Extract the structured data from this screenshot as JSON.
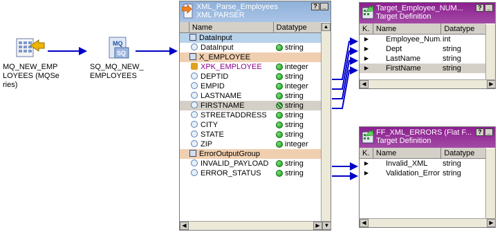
{
  "sources": [
    {
      "label": "MQ_NEW_EMP\nLOYEES (MQSe\nries)"
    },
    {
      "label": "SQ_MQ_NEW_\nEMPLOYEES"
    }
  ],
  "parser": {
    "title": "XML_Parse_Employees",
    "subtitle": "XML PARSER",
    "col_name": "Name",
    "col_type": "Datatype",
    "rows": [
      {
        "kind": "group",
        "name": "DataInput",
        "type": ""
      },
      {
        "kind": "field",
        "name": "DataInput",
        "type": "string"
      },
      {
        "kind": "group",
        "name": "X_EMPLOYEE",
        "type": ""
      },
      {
        "kind": "key",
        "name": "XPK_EMPLOYEE",
        "type": "integer"
      },
      {
        "kind": "field",
        "name": "DEPTID",
        "type": "string"
      },
      {
        "kind": "field",
        "name": "EMPID",
        "type": "integer"
      },
      {
        "kind": "field",
        "name": "LASTNAME",
        "type": "string"
      },
      {
        "kind": "field",
        "name": "FIRSTNAME",
        "type": "string"
      },
      {
        "kind": "field",
        "name": "STREETADDRESS",
        "type": "string"
      },
      {
        "kind": "field",
        "name": "CITY",
        "type": "string"
      },
      {
        "kind": "field",
        "name": "STATE",
        "type": "string"
      },
      {
        "kind": "field",
        "name": "ZIP",
        "type": "integer"
      },
      {
        "kind": "group",
        "name": "ErrorOutputGroup",
        "type": ""
      },
      {
        "kind": "field",
        "name": "INVALID_PAYLOAD",
        "type": "string"
      },
      {
        "kind": "field",
        "name": "ERROR_STATUS",
        "type": "string"
      }
    ]
  },
  "target1": {
    "title": "Target_Employee_NUM...",
    "subtitle": "Target Definition",
    "col_k": "K.",
    "col_name": "Name",
    "col_type": "Datatype",
    "rows": [
      {
        "name": "Employee_Num...",
        "type": "int"
      },
      {
        "name": "Dept",
        "type": "string"
      },
      {
        "name": "LastName",
        "type": "string"
      },
      {
        "name": "FirstName",
        "type": "string"
      }
    ]
  },
  "target2": {
    "title": "FF_XML_ERRORS (Flat F...",
    "subtitle": "Target Definition",
    "col_k": "K.",
    "col_name": "Name",
    "col_type": "Datatype",
    "rows": [
      {
        "name": "Invalid_XML",
        "type": "string"
      },
      {
        "name": "Validation_Error",
        "type": "string"
      }
    ]
  },
  "window_buttons": {
    "help": "?",
    "minimize": "_"
  },
  "colors": {
    "wire": "#0000c8",
    "parser_title": "#9bb8df",
    "target_title": "#8c1f8f"
  }
}
